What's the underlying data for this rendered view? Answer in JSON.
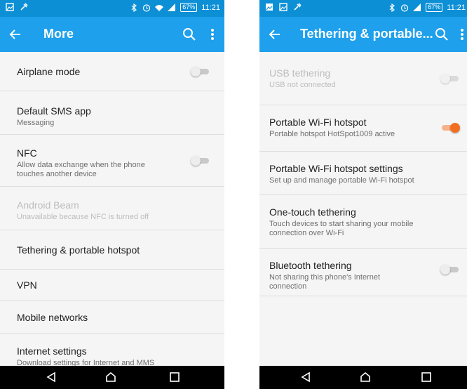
{
  "left": {
    "status": {
      "battery": "67%",
      "time": "11:21"
    },
    "toolbar": {
      "title": "More"
    },
    "items": [
      {
        "title": "Airplane mode",
        "subtitle": ""
      },
      {
        "title": "Default SMS app",
        "subtitle": "Messaging"
      },
      {
        "title": "NFC",
        "subtitle": "Allow data exchange when the phone touches another device"
      },
      {
        "title": "Android Beam",
        "subtitle": "Unavailable because NFC is turned off"
      },
      {
        "title": "Tethering & portable hotspot",
        "subtitle": ""
      },
      {
        "title": "VPN",
        "subtitle": ""
      },
      {
        "title": "Mobile networks",
        "subtitle": ""
      },
      {
        "title": "Internet settings",
        "subtitle": "Download settings for Internet and MMS"
      }
    ]
  },
  "right": {
    "status": {
      "battery": "67%",
      "time": "11:21"
    },
    "toolbar": {
      "title": "Tethering & portable..."
    },
    "items": [
      {
        "title": "USB tethering",
        "subtitle": "USB not connected"
      },
      {
        "title": "Portable Wi-Fi hotspot",
        "subtitle": "Portable hotspot HotSpot1009 active"
      },
      {
        "title": "Portable Wi-Fi hotspot settings",
        "subtitle": "Set up and manage portable Wi-Fi hotspot"
      },
      {
        "title": "One-touch tethering",
        "subtitle": "Touch devices to start sharing your mobile connection over Wi-Fi"
      },
      {
        "title": "Bluetooth tethering",
        "subtitle": "Not sharing this phone's Internet connection"
      }
    ]
  },
  "colors": {
    "status_bar": "#0d8fd6",
    "toolbar": "#1ea0ec",
    "switch_on": "#f26f21",
    "switch_off": "#c9c9c9"
  },
  "icons": {
    "status_left": [
      "image-icon",
      "gallery-icon",
      "wrench-icon"
    ],
    "status_right": [
      "bluetooth-icon",
      "alarm-icon",
      "wifi-icon",
      "signal-icon",
      "battery-icon"
    ],
    "toolbar": [
      "back-arrow-icon",
      "search-icon",
      "overflow-menu-icon"
    ],
    "nav": [
      "back-icon",
      "home-icon",
      "recents-icon"
    ]
  },
  "switches": {
    "airplane_mode": false,
    "nfc": false,
    "usb_tethering": false,
    "wifi_hotspot": true,
    "bluetooth_tethering": false
  }
}
